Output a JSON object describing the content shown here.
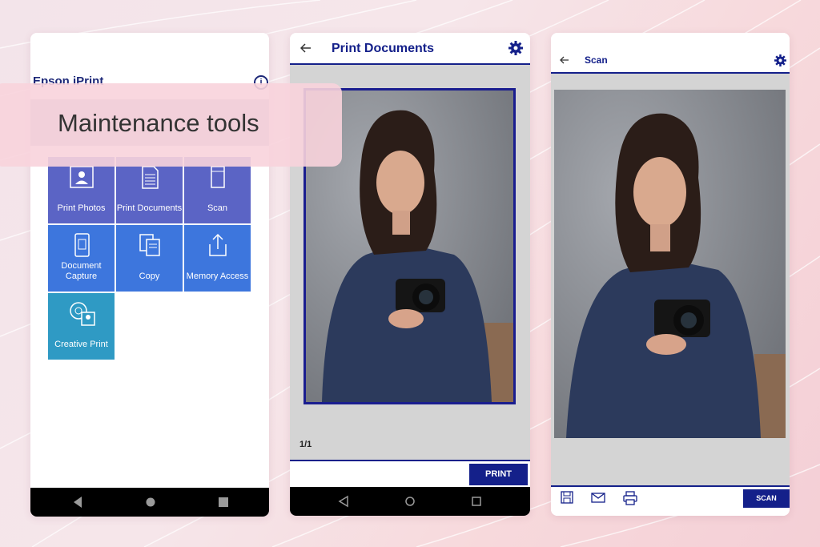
{
  "overlay": {
    "label": "Maintenance tools"
  },
  "home": {
    "app_title": "Epson iPrint",
    "tiles": [
      {
        "label": "Print Photos",
        "icon": "photo-icon"
      },
      {
        "label": "Print Documents",
        "icon": "document-icon"
      },
      {
        "label": "Scan",
        "icon": "scan-icon"
      },
      {
        "label": "Document Capture",
        "icon": "phone-capture-icon"
      },
      {
        "label": "Copy",
        "icon": "copy-icon"
      },
      {
        "label": "Memory Access",
        "icon": "upload-icon"
      },
      {
        "label": "Creative Print",
        "icon": "creative-print-icon"
      }
    ]
  },
  "print_documents": {
    "title": "Print Documents",
    "page_counter": "1/1",
    "print_label": "PRINT"
  },
  "scan": {
    "title": "Scan",
    "scan_label": "SCAN",
    "bottom_icons": [
      "save-icon",
      "mail-icon",
      "printer-icon"
    ]
  },
  "colors": {
    "accent": "#14208a",
    "tile_purple": "#5b64c5",
    "tile_blue": "#3d76dd",
    "tile_teal": "#2f9ac4"
  }
}
